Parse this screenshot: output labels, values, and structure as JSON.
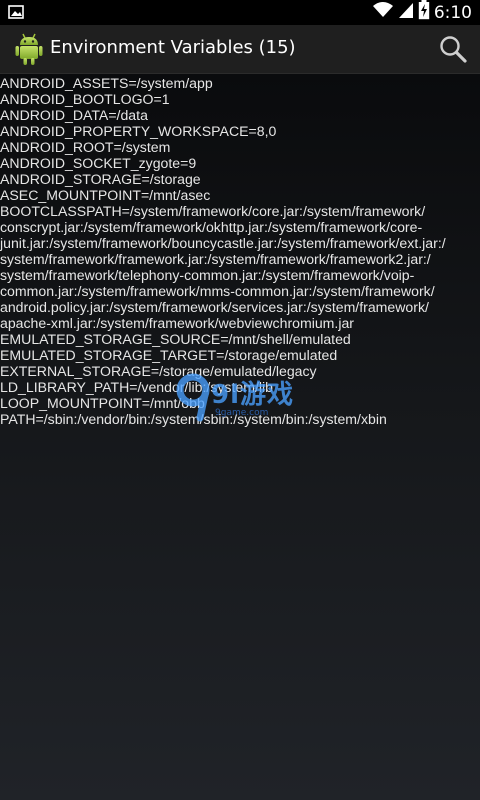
{
  "status_bar": {
    "time": "6:10",
    "icons": [
      "picture-icon",
      "wifi-icon",
      "signal-icon",
      "battery-charging-icon"
    ]
  },
  "app_bar": {
    "title": "Environment Variables (15)",
    "icon": "android-icon",
    "action_icon": "search-icon"
  },
  "env_lines": [
    "ANDROID_ASSETS=/system/app",
    "ANDROID_BOOTLOGO=1",
    "ANDROID_DATA=/data",
    "ANDROID_PROPERTY_WORKSPACE=8,0",
    "ANDROID_ROOT=/system",
    "ANDROID_SOCKET_zygote=9",
    "ANDROID_STORAGE=/storage",
    "ASEC_MOUNTPOINT=/mnt/asec",
    "BOOTCLASSPATH=/system/framework/core.jar:/system/framework/",
    "conscrypt.jar:/system/framework/okhttp.jar:/system/framework/core-",
    "junit.jar:/system/framework/bouncycastle.jar:/system/framework/ext.jar:/",
    "system/framework/framework.jar:/system/framework/framework2.jar:/",
    "system/framework/telephony-common.jar:/system/framework/voip-",
    "common.jar:/system/framework/mms-common.jar:/system/framework/",
    "android.policy.jar:/system/framework/services.jar:/system/framework/",
    "apache-xml.jar:/system/framework/webviewchromium.jar",
    "EMULATED_STORAGE_SOURCE=/mnt/shell/emulated",
    "EMULATED_STORAGE_TARGET=/storage/emulated",
    "EXTERNAL_STORAGE=/storage/emulated/legacy",
    "LD_LIBRARY_PATH=/vendor/lib:/system/lib",
    "LOOP_MOUNTPOINT=/mnt/obb",
    "PATH=/sbin:/vendor/bin:/system/sbin:/system/bin:/system/xbin"
  ],
  "watermark": {
    "text": "9l游戏",
    "sub": "9game.com"
  },
  "colors": {
    "status_bar_bg": "#000000",
    "app_bar_bg": "#1f1f1f",
    "text": "#e6e6e6",
    "android_green": "#a4c639"
  }
}
